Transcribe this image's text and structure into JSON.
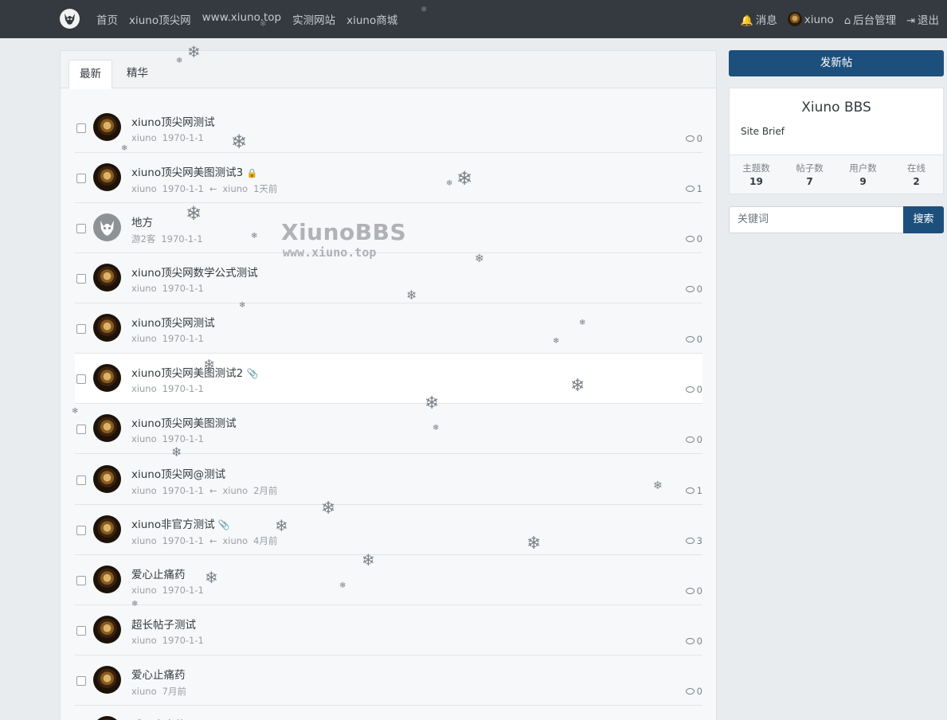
{
  "nav": {
    "left": [
      "首页",
      "xiuno顶尖网",
      "www.xiuno.top",
      "实测网站",
      "xiuno商城"
    ],
    "messages": "消息",
    "user": "xiuno",
    "admin": "后台管理",
    "logout": "退出"
  },
  "tabs": [
    "最新",
    "精华"
  ],
  "threads": [
    {
      "subject": "xiuno顶尖网测试",
      "author": "xiuno",
      "date": "1970-1-1",
      "last_user": "",
      "last_time": "",
      "replies": "0",
      "avatar": "user",
      "icon": ""
    },
    {
      "subject": "xiuno顶尖网美图测试3",
      "author": "xiuno",
      "date": "1970-1-1",
      "last_user": "xiuno",
      "last_time": "1天前",
      "replies": "1",
      "avatar": "user",
      "icon": "lock-icon"
    },
    {
      "subject": "地方",
      "author": "游2客",
      "date": "1970-1-1",
      "last_user": "",
      "last_time": "",
      "replies": "0",
      "avatar": "guest",
      "icon": ""
    },
    {
      "subject": "xiuno顶尖网数学公式测试",
      "author": "xiuno",
      "date": "1970-1-1",
      "last_user": "",
      "last_time": "",
      "replies": "0",
      "avatar": "user",
      "icon": ""
    },
    {
      "subject": "xiuno顶尖网测试",
      "author": "xiuno",
      "date": "1970-1-1",
      "last_user": "",
      "last_time": "",
      "replies": "0",
      "avatar": "user",
      "icon": ""
    },
    {
      "subject": "xiuno顶尖网美图测试2",
      "author": "xiuno",
      "date": "1970-1-1",
      "last_user": "",
      "last_time": "",
      "replies": "0",
      "avatar": "user",
      "icon": "paperclip-icon"
    },
    {
      "subject": "xiuno顶尖网美图测试",
      "author": "xiuno",
      "date": "1970-1-1",
      "last_user": "",
      "last_time": "",
      "replies": "0",
      "avatar": "user",
      "icon": ""
    },
    {
      "subject": "xiuno顶尖网@测试",
      "author": "xiuno",
      "date": "1970-1-1",
      "last_user": "xiuno",
      "last_time": "2月前",
      "replies": "1",
      "avatar": "user",
      "icon": ""
    },
    {
      "subject": "xiuno非官方测试",
      "author": "xiuno",
      "date": "1970-1-1",
      "last_user": "xiuno",
      "last_time": "4月前",
      "replies": "3",
      "avatar": "user",
      "icon": "paperclip-icon"
    },
    {
      "subject": "爱心止痛药",
      "author": "xiuno",
      "date": "1970-1-1",
      "last_user": "",
      "last_time": "",
      "replies": "0",
      "avatar": "user",
      "icon": ""
    },
    {
      "subject": "超长帖子测试",
      "author": "xiuno",
      "date": "1970-1-1",
      "last_user": "",
      "last_time": "",
      "replies": "0",
      "avatar": "user",
      "icon": ""
    },
    {
      "subject": "爱心止痛药",
      "author": "xiuno",
      "date": "7月前",
      "last_user": "",
      "last_time": "",
      "replies": "0",
      "avatar": "user",
      "icon": ""
    },
    {
      "subject": "爱心止痛药",
      "author": "",
      "date": "",
      "last_user": "",
      "last_time": "",
      "replies": "",
      "avatar": "user",
      "icon": ""
    }
  ],
  "sidebar": {
    "new_thread": "发新帖",
    "site_name": "Xiuno BBS",
    "site_brief": "Site Brief",
    "stats": [
      {
        "label": "主题数",
        "value": "19"
      },
      {
        "label": "帖子数",
        "value": "7"
      },
      {
        "label": "用户数",
        "value": "9"
      },
      {
        "label": "在线",
        "value": "2"
      }
    ],
    "search_placeholder": "关键词",
    "search_button": "搜索"
  },
  "watermark": {
    "line1": "XiunoBBS",
    "line2": "www.xiuno.top"
  },
  "reply_arrow": "←",
  "accent_color": "#1d4f7c"
}
